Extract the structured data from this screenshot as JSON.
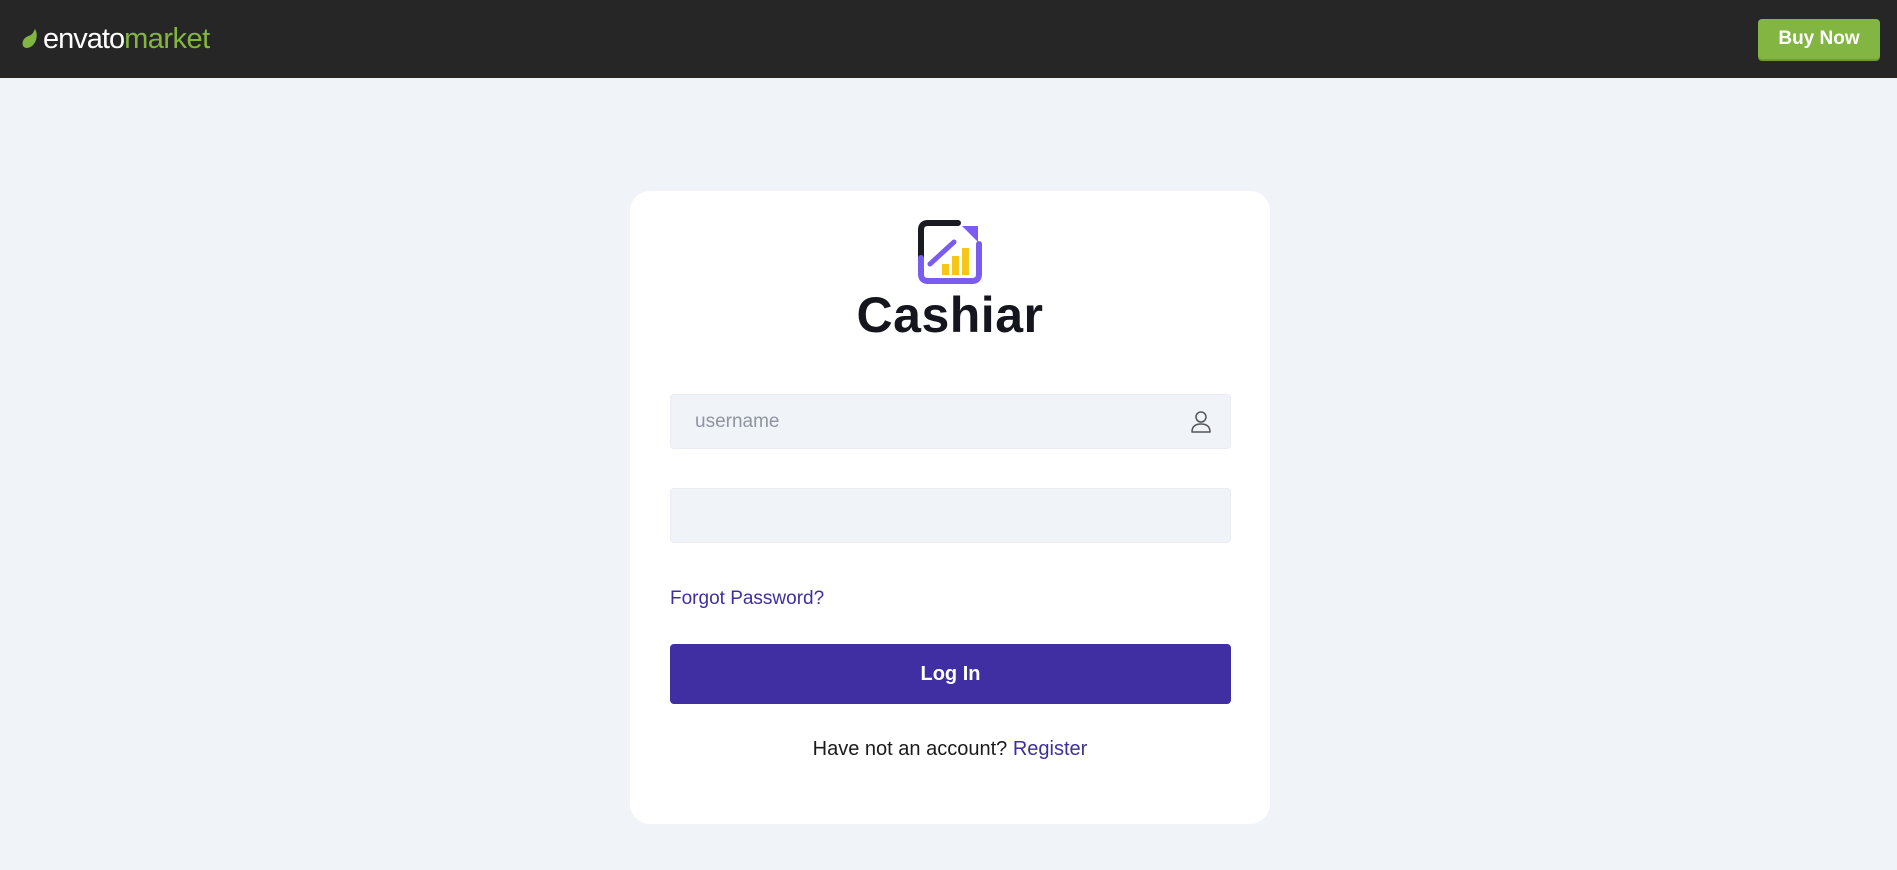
{
  "header": {
    "brand_envato": "envato",
    "brand_market": "market",
    "buy_now_label": "Buy Now",
    "accent_color": "#82b541",
    "background_color": "#262626"
  },
  "login": {
    "app_name": "Cashiar",
    "logo_icon": "growth-chart-icon",
    "username_placeholder": "username",
    "username_value": "",
    "password_value": "",
    "user_icon": "user-icon",
    "forgot_password_label": "Forgot Password?",
    "login_button_label": "Log In",
    "register_prompt": "Have not an account?",
    "register_link_label": "Register",
    "primary_color": "#3f2fa3"
  }
}
